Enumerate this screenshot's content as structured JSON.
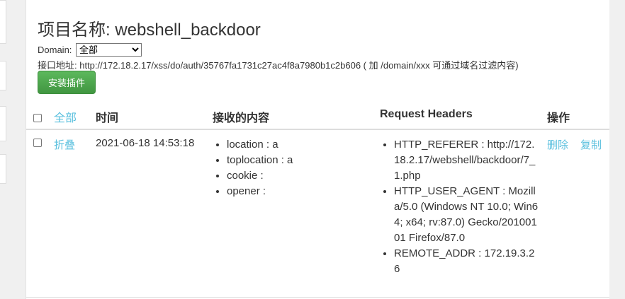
{
  "project": {
    "title": "项目名称: webshell_backdoor",
    "domain_label": "Domain:",
    "domain_selected": "全部",
    "api_text": "接口地址: http://172.18.2.17/xss/do/auth/35767fa1731c27ac4f8a7980b1c2b606 ( 加 /domain/xxx 可通过域名过滤内容)",
    "install_button": "安装插件"
  },
  "table": {
    "headers": {
      "select_all": "全部",
      "time": "时间",
      "content": "接收的内容",
      "request_headers": "Request Headers",
      "actions": "操作"
    },
    "rows": [
      {
        "toggle": "折叠",
        "time": "2021-06-18 14:53:18",
        "content": [
          "location : a",
          "toplocation : a",
          "cookie :",
          "opener :"
        ],
        "headers": [
          "HTTP_REFERER : http://172.18.2.17/webshell/backdoor/7_1.php",
          "HTTP_USER_AGENT : Mozilla/5.0 (Windows NT 10.0; Win64; x64; rv:87.0) Gecko/20100101 Firefox/87.0",
          "REMOTE_ADDR : 172.19.3.26"
        ],
        "delete": "删除",
        "copy": "复制"
      }
    ]
  }
}
